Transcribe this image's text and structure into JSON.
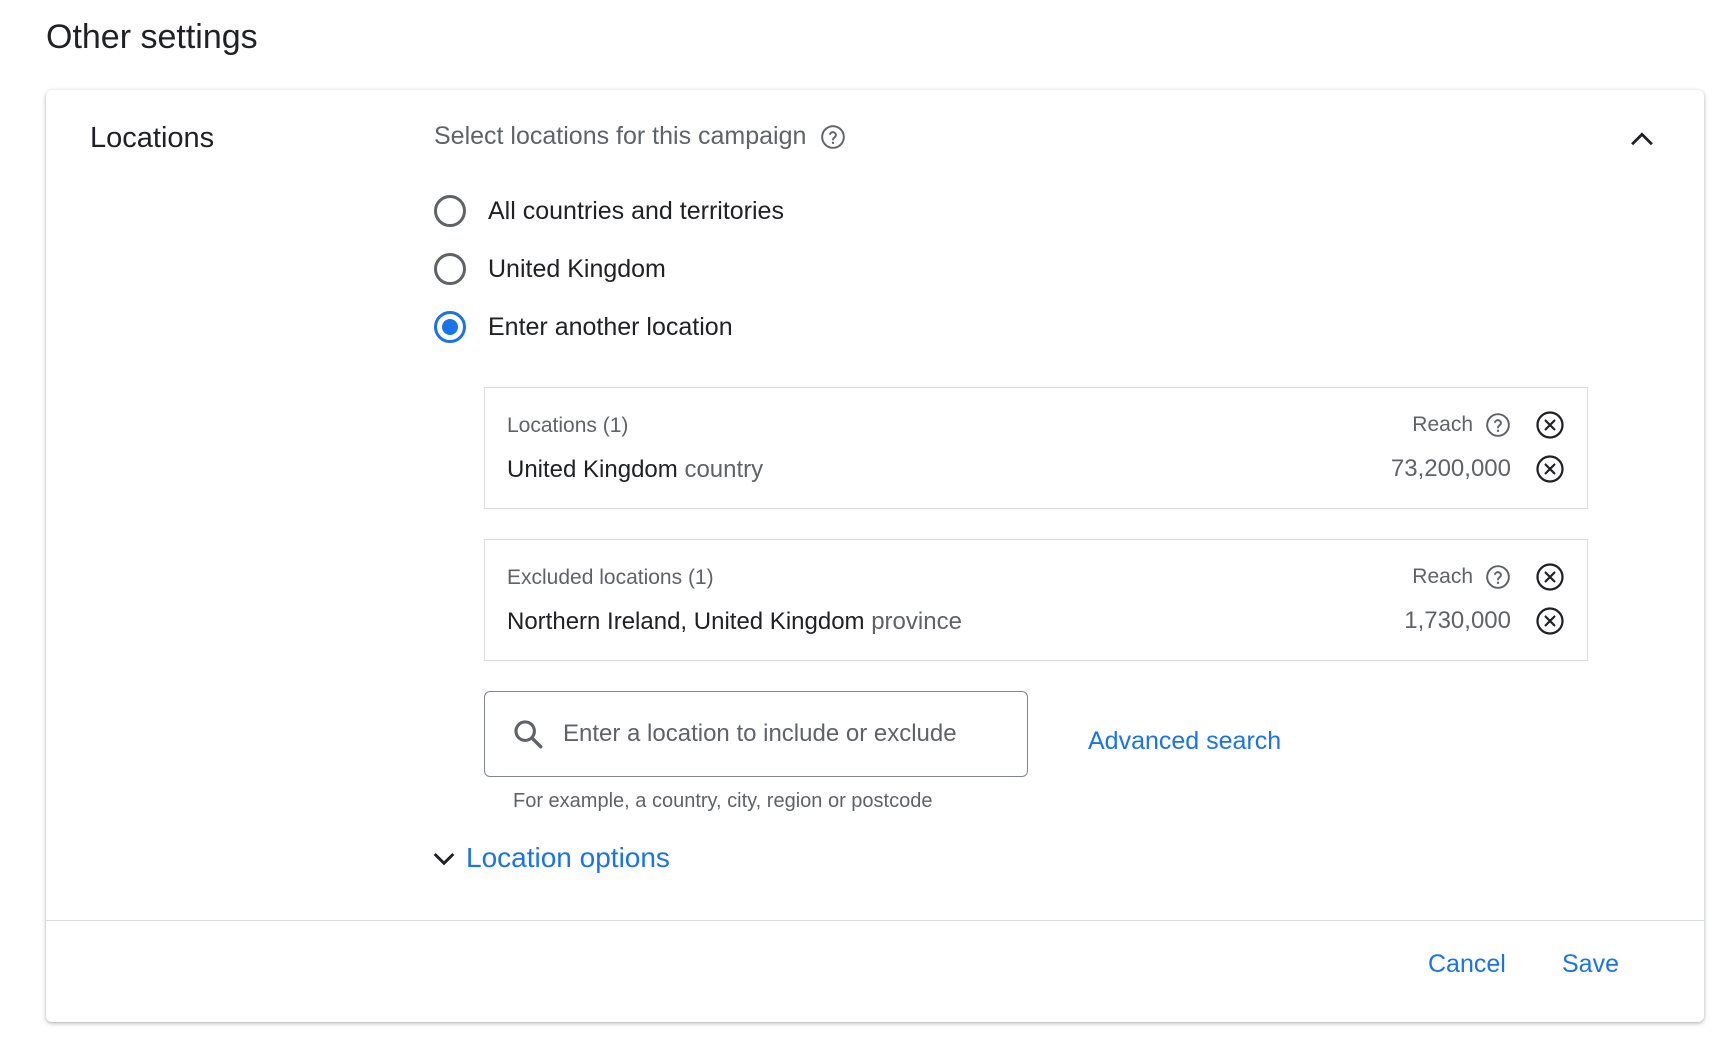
{
  "page": {
    "title": "Other settings"
  },
  "locations": {
    "title": "Locations",
    "header": "Select locations for this campaign",
    "options": [
      {
        "label": "All countries and territories",
        "checked": false
      },
      {
        "label": "United Kingdom",
        "checked": false
      },
      {
        "label": "Enter another location",
        "checked": true
      }
    ],
    "included": {
      "label": "Locations (1)",
      "reach_label": "Reach",
      "item": {
        "name": "United Kingdom",
        "type": "country",
        "reach": "73,200,000"
      }
    },
    "excluded": {
      "label": "Excluded locations (1)",
      "reach_label": "Reach",
      "item": {
        "name": "Northern Ireland, United Kingdom",
        "type": "province",
        "reach": "1,730,000"
      }
    },
    "search": {
      "placeholder": "Enter a location to include or exclude",
      "hint": "For example, a country, city, region or postcode"
    },
    "advanced_search": "Advanced search",
    "location_options": "Location options"
  },
  "footer": {
    "cancel": "Cancel",
    "save": "Save"
  },
  "colors": {
    "accent": "#1a73e8",
    "text": "#202124",
    "muted": "#5f6368",
    "border": "#dadce0"
  }
}
